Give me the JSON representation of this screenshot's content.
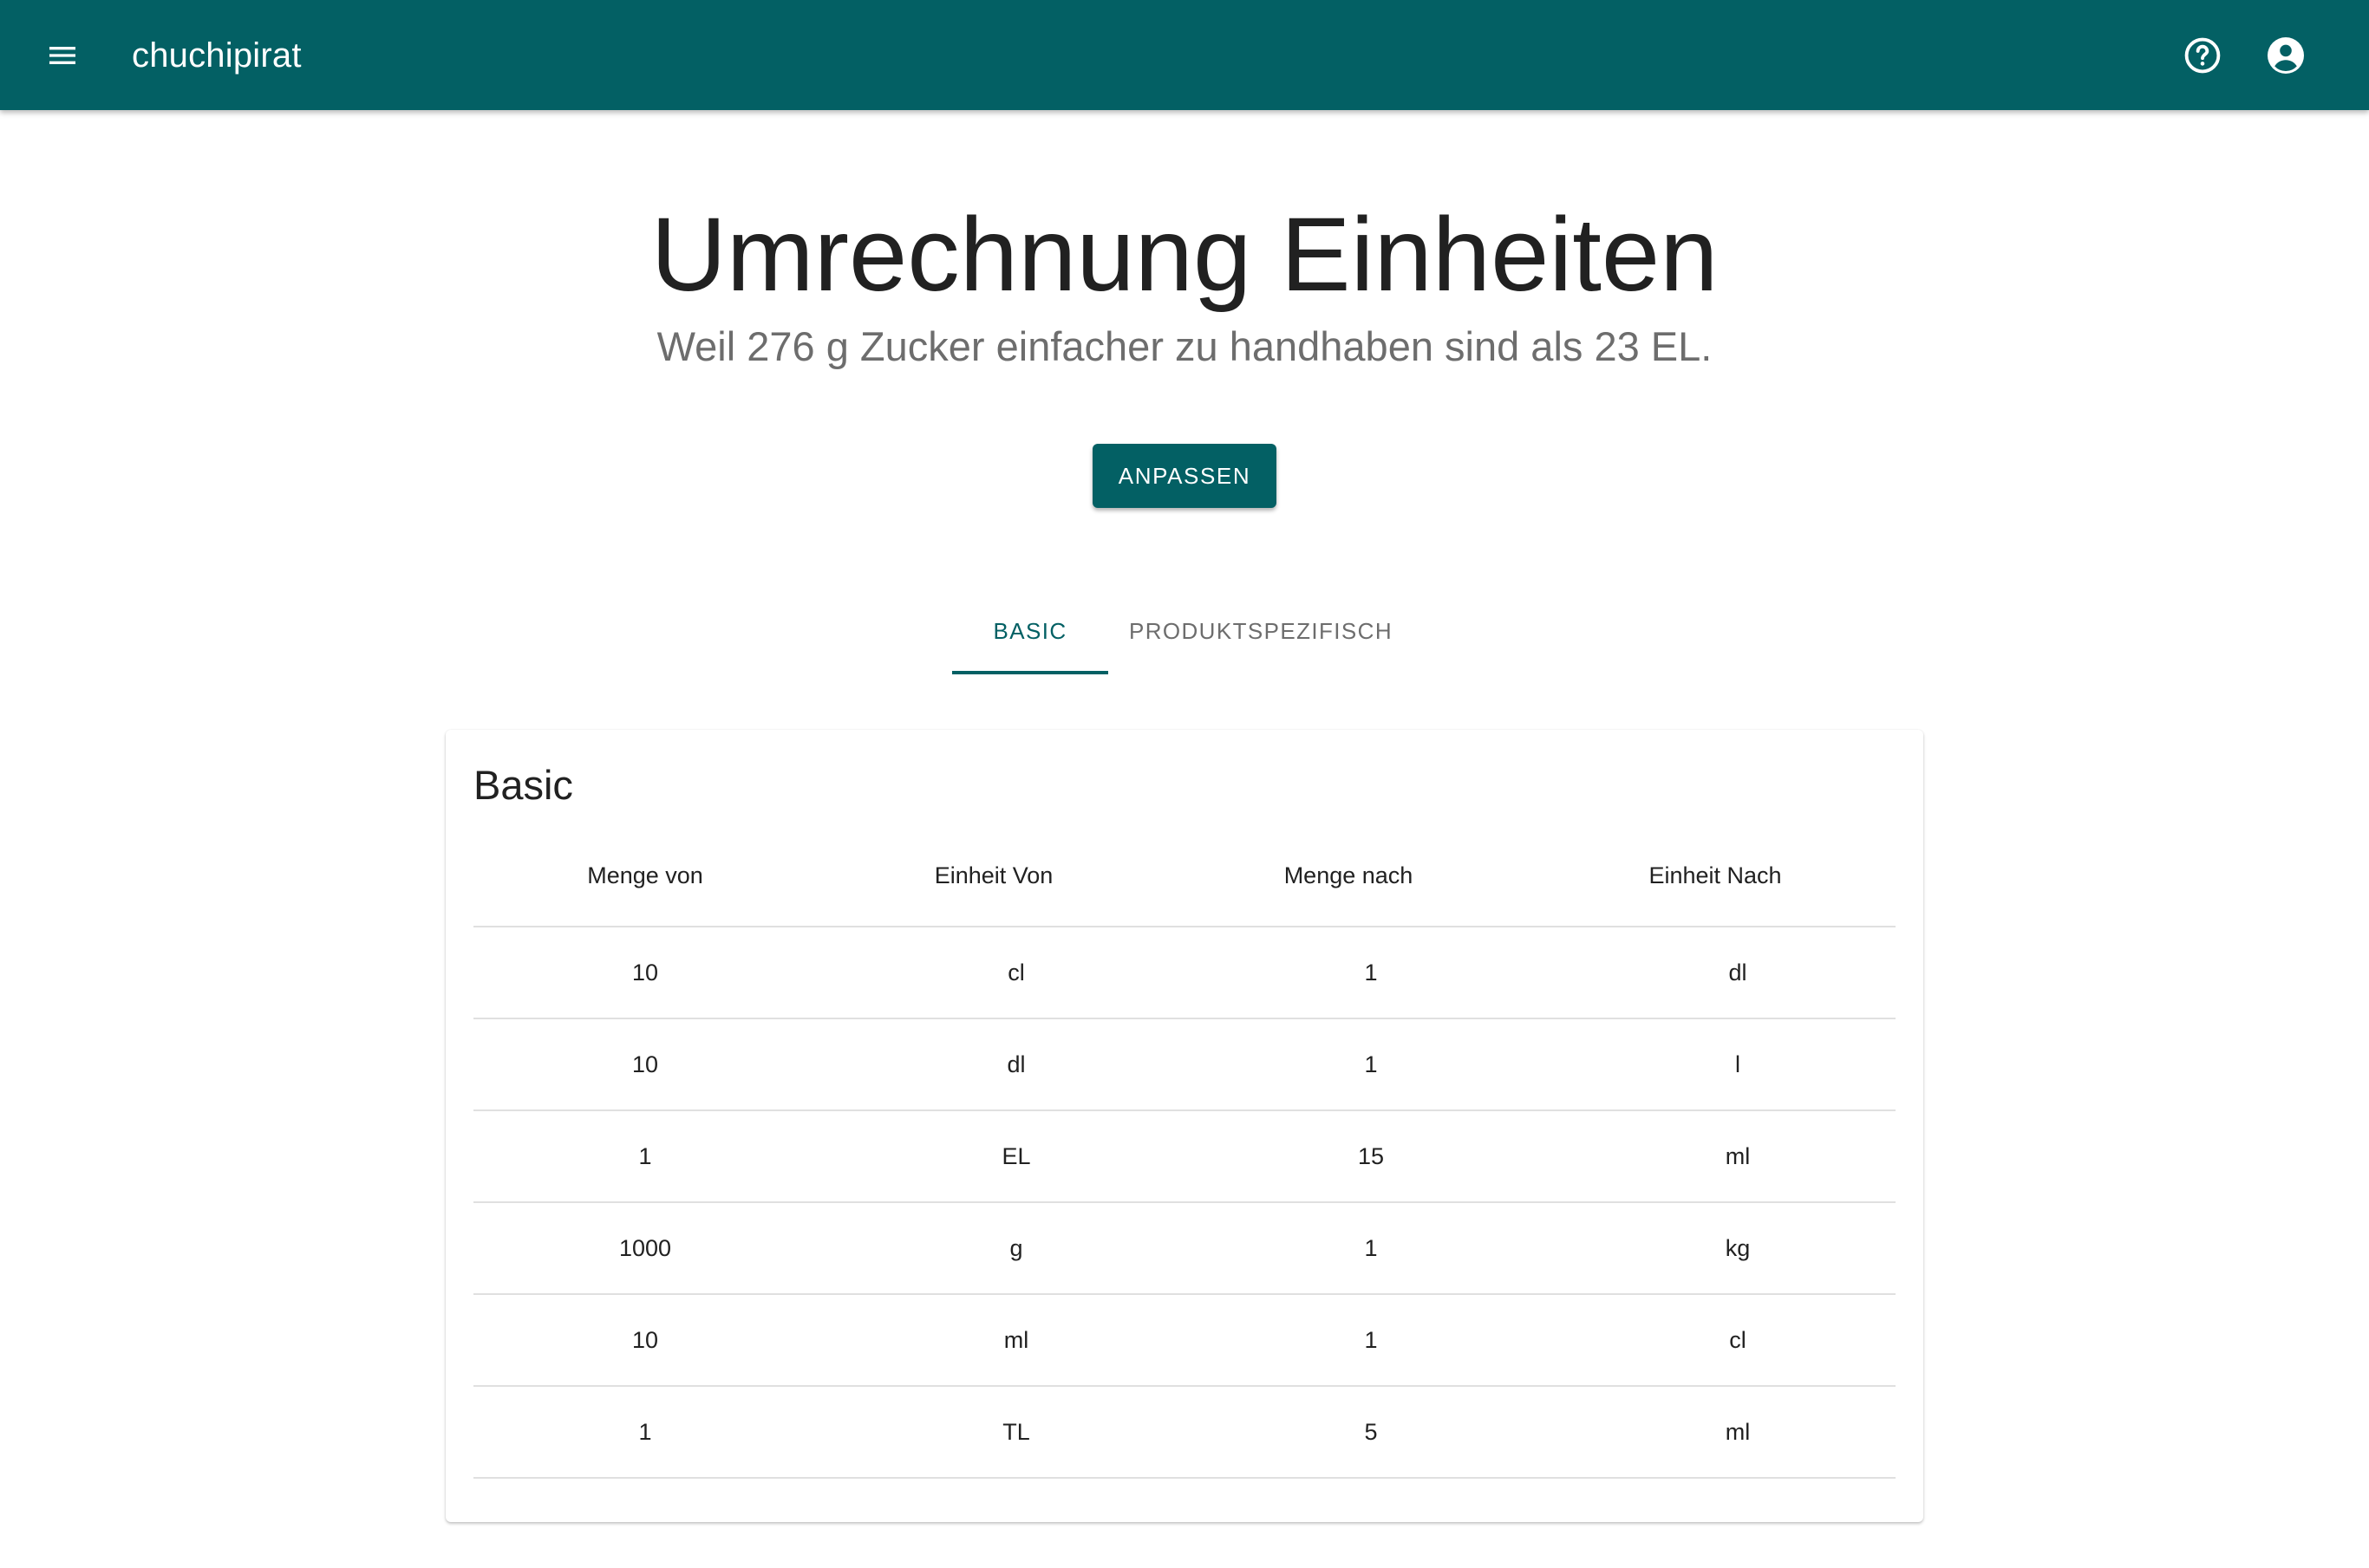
{
  "appbar": {
    "title": "chuchipirat",
    "menu_icon": "menu-icon",
    "help_icon": "help-circle-icon",
    "account_icon": "account-circle-icon",
    "color": "#036064"
  },
  "header": {
    "title": "Umrechnung Einheiten",
    "subtitle": "Weil 276 g Zucker einfacher zu handhaben sind als 23 EL."
  },
  "actions": {
    "adjust_label": "ANPASSEN"
  },
  "tabs": [
    {
      "label": "BASIC",
      "active": true
    },
    {
      "label": "PRODUKTSPEZIFISCH",
      "active": false
    }
  ],
  "card": {
    "title": "Basic",
    "columns": [
      "Menge von",
      "Einheit Von",
      "Menge nach",
      "Einheit Nach"
    ],
    "rows": [
      [
        "10",
        "cl",
        "1",
        "dl"
      ],
      [
        "10",
        "dl",
        "1",
        "l"
      ],
      [
        "1",
        "EL",
        "15",
        "ml"
      ],
      [
        "1000",
        "g",
        "1",
        "kg"
      ],
      [
        "10",
        "ml",
        "1",
        "cl"
      ],
      [
        "1",
        "TL",
        "5",
        "ml"
      ]
    ]
  }
}
